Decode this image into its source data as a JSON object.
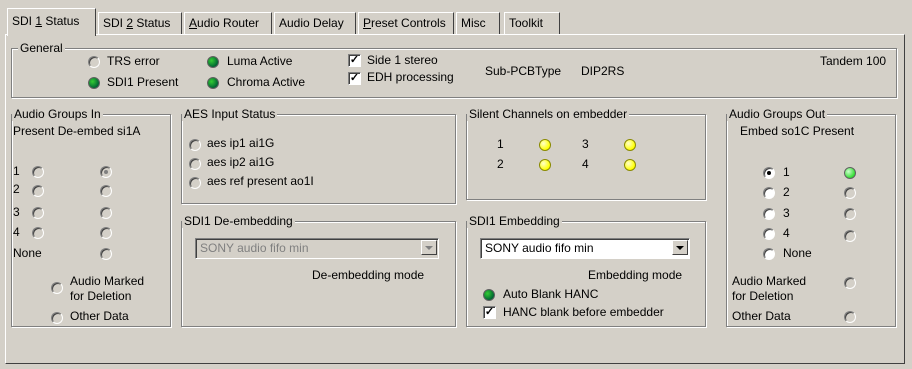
{
  "tabs": [
    {
      "pre": "SDI ",
      "mn": "1",
      "post": " Status"
    },
    {
      "pre": "SDI ",
      "mn": "2",
      "post": " Status"
    },
    {
      "pre": "",
      "mn": "A",
      "post": "udio Router"
    },
    {
      "pre": "Audio Delay",
      "mn": "",
      "post": ""
    },
    {
      "pre": "",
      "mn": "P",
      "post": "reset Controls"
    },
    {
      "pre": "Misc",
      "mn": "",
      "post": ""
    },
    {
      "pre": "Toolkit",
      "mn": "",
      "post": ""
    }
  ],
  "general": {
    "title": "General",
    "trs_error": "TRS error",
    "sdi1_present": "SDI1 Present",
    "luma_active": "Luma Active",
    "chroma_active": "Chroma Active",
    "side1_stereo": "Side 1 stereo",
    "edh_processing": "EDH processing",
    "check_mark": "✓",
    "subpcb_label": "Sub-PCBType",
    "subpcb_value": "DIP2RS",
    "device": "Tandem 100"
  },
  "audio_in": {
    "title": "Audio Groups In",
    "header": "Present De-embed si1A",
    "groups": [
      "1",
      "2",
      "3",
      "4",
      "None"
    ],
    "marked_line1": "Audio Marked",
    "marked_line2": "for Deletion",
    "other": "Other Data"
  },
  "aes": {
    "title": "AES Input Status",
    "items": [
      "aes ip1  ai1G",
      "aes ip2  ai1G",
      "aes ref  present ao1I"
    ]
  },
  "silent": {
    "title": "Silent Channels  on embedder",
    "ch": [
      "1",
      "2",
      "3",
      "4"
    ]
  },
  "deembed": {
    "title": "SDI1 De-embedding",
    "combo": "SONY  audio fifo min",
    "mode": "De-embedding mode"
  },
  "embed": {
    "title": "SDI1 Embedding",
    "combo": "SONY  audio fifo min",
    "mode": "Embedding mode",
    "auto_blank": "Auto Blank HANC",
    "hanc_blank": "HANC blank before embedder"
  },
  "audio_out": {
    "title": "Audio Groups Out",
    "header": "Embed so1C  Present",
    "groups": [
      "1",
      "2",
      "3",
      "4",
      "None"
    ],
    "marked_line1": "Audio Marked",
    "marked_line2": "for Deletion",
    "other": "Other Data"
  }
}
